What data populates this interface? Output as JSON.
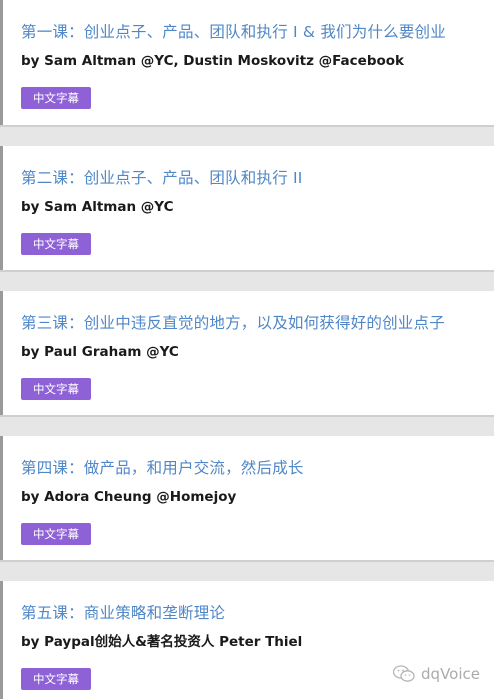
{
  "lessons": [
    {
      "title": "第一课：创业点子、产品、团队和执行 I & 我们为什么要创业",
      "author": "by Sam Altman @YC, Dustin Moskovitz @Facebook",
      "badge": "中文字幕"
    },
    {
      "title": "第二课：创业点子、产品、团队和执行 II",
      "author": "by Sam Altman @YC",
      "badge": "中文字幕"
    },
    {
      "title": "第三课：创业中违反直觉的地方，以及如何获得好的创业点子",
      "author": "by Paul Graham @YC",
      "badge": "中文字幕"
    },
    {
      "title": "第四课：做产品，和用户交流，然后成长",
      "author": "by Adora Cheung @Homejoy",
      "badge": "中文字幕"
    },
    {
      "title": "第五课：商业策略和垄断理论",
      "author": "by Paypal创始人&著名投资人 Peter Thiel",
      "badge": "中文字幕"
    }
  ],
  "watermark": {
    "text": "dqVoice",
    "icon": "wechat-icon"
  }
}
